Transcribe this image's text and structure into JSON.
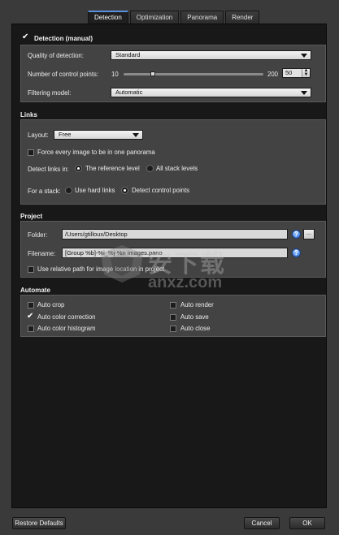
{
  "tabs": [
    "Detection",
    "Optimization",
    "Panorama",
    "Render"
  ],
  "detection": {
    "header": "Detection (manual)",
    "quality_label": "Quality of detection:",
    "quality_value": "Standard",
    "control_points_label": "Number of control points:",
    "cp_min": "10",
    "cp_max": "200",
    "cp_value": "50",
    "filtering_label": "Filtering model:",
    "filtering_value": "Automatic"
  },
  "links": {
    "title": "Links",
    "layout_label": "Layout:",
    "layout_value": "Free",
    "force_label": "Force every image to be in one panorama",
    "detect_label": "Detect links in:",
    "reference_level": "The reference level",
    "all_stack_levels": "All stack levels",
    "stack_label": "For a stack:",
    "hard_links": "Use hard links",
    "detect_cp": "Detect control points"
  },
  "project": {
    "title": "Project",
    "folder_label": "Folder:",
    "folder_value": "/Users/gtilloux/Desktop",
    "filename_label": "Filename:",
    "filename_value": "[Group %b]-%i_%j-%n images.pano",
    "relative_label": "Use relative path for image location in project",
    "browse_label": "..."
  },
  "automate": {
    "title": "Automate",
    "auto_crop": "Auto crop",
    "auto_color_correction": "Auto color correction",
    "auto_color_histogram": "Auto color histogram",
    "auto_render": "Auto render",
    "auto_save": "Auto save",
    "auto_close": "Auto close"
  },
  "footer": {
    "restore": "Restore Defaults",
    "cancel": "Cancel",
    "ok": "OK"
  },
  "watermark": {
    "text": "anxz.com",
    "cn": "安下载"
  },
  "state": {
    "quality_slider_fraction": 0.21,
    "detect_links": "reference",
    "stack_mode": "detect",
    "checked": [
      "detection_manual",
      "auto_color_correction"
    ]
  },
  "colors": {
    "accent": "#5b8fd9",
    "help_icon": "#2a6fe0"
  }
}
